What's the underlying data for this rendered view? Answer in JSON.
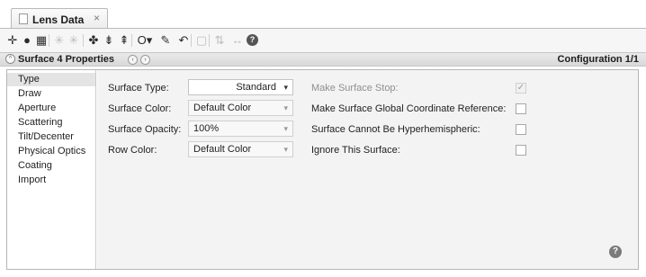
{
  "tab": {
    "title": "Lens Data",
    "close_glyph": "×",
    "icon": "document-icon"
  },
  "toolbar": {
    "items": [
      {
        "name": "add-surface-icon",
        "glyph": "✛",
        "dim": false
      },
      {
        "name": "globe-icon",
        "glyph": "●",
        "dim": false
      },
      {
        "name": "grid-icon",
        "glyph": "▦",
        "dim": false
      },
      {
        "name": "ray-icon-1",
        "glyph": "✳",
        "dim": true
      },
      {
        "name": "ray-icon-2",
        "glyph": "✳",
        "dim": true
      },
      {
        "name": "lens-icon-1",
        "glyph": "✤",
        "dim": false
      },
      {
        "name": "lens-icon-2",
        "glyph": "⇟",
        "dim": false
      },
      {
        "name": "lens-icon-3",
        "glyph": "⇞",
        "dim": false
      },
      {
        "name": "circle-dropdown-icon",
        "glyph": "O▾",
        "dim": false
      },
      {
        "name": "pencil-icon",
        "glyph": "✎",
        "dim": false
      },
      {
        "name": "undo-arrow-icon",
        "glyph": "↶",
        "dim": false
      },
      {
        "name": "blank-icon",
        "glyph": "▢",
        "dim": true
      },
      {
        "name": "swap-icon",
        "glyph": "⇅",
        "dim": true
      },
      {
        "name": "arrow-lr-icon",
        "glyph": "↔",
        "dim": true
      },
      {
        "name": "help-circle-icon",
        "glyph": "?",
        "dim": false
      }
    ]
  },
  "properties": {
    "title": "Surface 4 Properties",
    "prev_glyph": "‹",
    "next_glyph": "›",
    "collapse_glyph": "^",
    "configuration": "Configuration 1/1"
  },
  "sidebar": {
    "items": [
      {
        "label": "Type",
        "active": true
      },
      {
        "label": "Draw",
        "active": false
      },
      {
        "label": "Aperture",
        "active": false
      },
      {
        "label": "Scattering",
        "active": false
      },
      {
        "label": "Tilt/Decenter",
        "active": false
      },
      {
        "label": "Physical Optics",
        "active": false
      },
      {
        "label": "Coating",
        "active": false
      },
      {
        "label": "Import",
        "active": false
      }
    ]
  },
  "form": {
    "surface_type_label": "Surface Type:",
    "surface_type_value": "Standard",
    "surface_color_label": "Surface Color:",
    "surface_color_value": "Default Color",
    "surface_opacity_label": "Surface Opacity:",
    "surface_opacity_value": "100%",
    "row_color_label": "Row Color:",
    "row_color_value": "Default Color",
    "make_stop_label": "Make Surface Stop:",
    "make_stop_checked": true,
    "make_stop_disabled": true,
    "global_ref_label": "Make Surface Global Coordinate Reference:",
    "global_ref_checked": false,
    "hyperhemi_label": "Surface Cannot Be Hyperhemispheric:",
    "hyperhemi_checked": false,
    "ignore_label": "Ignore This Surface:",
    "ignore_checked": false,
    "check_glyph": "✓",
    "arrow_glyph": "▾"
  },
  "help_glyph": "?"
}
